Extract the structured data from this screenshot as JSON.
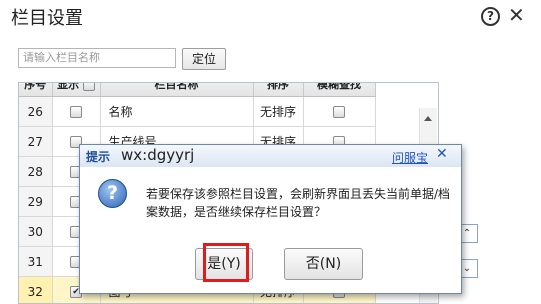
{
  "window": {
    "title": "栏目设置"
  },
  "search": {
    "placeholder": "请输入栏目名称",
    "button": "定位"
  },
  "table": {
    "columns": [
      "序号",
      "显示",
      "栏目名称",
      "排序",
      "模糊查找"
    ],
    "rows": [
      {
        "num": "26",
        "show": false,
        "name": "名称",
        "sort": "无排序",
        "fuzzy": false
      },
      {
        "num": "27",
        "show": false,
        "name": "生产线号",
        "sort": "无排序",
        "fuzzy": false
      },
      {
        "num": "28",
        "show": false,
        "name": "",
        "sort": "",
        "fuzzy": false
      },
      {
        "num": "29",
        "show": false,
        "name": "",
        "sort": "",
        "fuzzy": false
      },
      {
        "num": "30",
        "show": false,
        "name": "",
        "sort": "",
        "fuzzy": false
      },
      {
        "num": "31",
        "show": false,
        "name": "",
        "sort": "",
        "fuzzy": false
      },
      {
        "num": "32",
        "show": true,
        "name": "图号",
        "sort": "无排序",
        "fuzzy": true
      }
    ]
  },
  "dialog": {
    "title": "提示",
    "watermark": "wx:dgyyrj",
    "link": "问服宝",
    "message": "若要保存该参照栏目设置，会刷新界面且丢失当前单据/档案数据，是否继续保存栏目设置？",
    "yes": "是(Y)",
    "no": "否(N)"
  }
}
